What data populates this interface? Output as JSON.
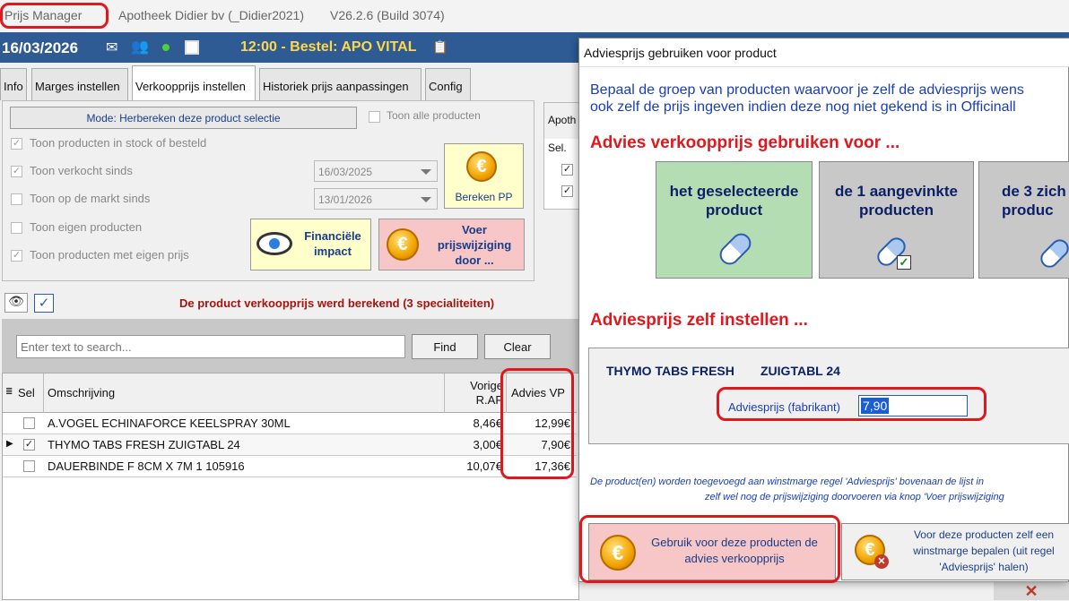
{
  "window": {
    "app_name": "Prijs Manager",
    "subtitle": "Apotheek Didier bv (_Didier2021)",
    "version": "V26.2.6  (Build 3074)"
  },
  "topbar": {
    "date": "16/03/2026",
    "order": "12:00 - Bestel: APO VITAL"
  },
  "tabs": [
    {
      "label": "Info"
    },
    {
      "label": "Marges instellen"
    },
    {
      "label": "Verkoopprijs instellen"
    },
    {
      "label": "Historiek prijs aanpassingen"
    },
    {
      "label": "Config"
    }
  ],
  "filters": {
    "mode_label": "Mode: Herbereken deze product selectie",
    "show_all": "Toon alle producten",
    "stock_label": "Toon producten in stock of besteld",
    "sold_label": "Toon verkocht sinds",
    "sold_date": "16/03/2025",
    "market_label": "Toon op de markt sinds",
    "market_date": "13/01/2026",
    "own_products": "Toon eigen producten",
    "own_price": "Toon producten met eigen prijs"
  },
  "actions": {
    "bereken": "Bereken PP",
    "financial": "Financiële impact",
    "execute": "Voer prijswijziging door ..."
  },
  "right_panel": {
    "header": "Apoth",
    "sel": "Sel."
  },
  "status_message": "De product verkoopprijs werd berekend (3 specialiteiten)",
  "search": {
    "placeholder": "Enter text to search...",
    "find": "Find",
    "clear": "Clear"
  },
  "table": {
    "headers": {
      "sel": "Sel",
      "desc": "Omschrijving",
      "prev": "Vorige R.AP",
      "advies": "Advies VP"
    },
    "rows": [
      {
        "checked": "",
        "desc": "A.VOGEL ECHINAFORCE KEELSPRAY  30ML",
        "prev": "8,46€",
        "advies": "12,99€"
      },
      {
        "checked": "✓",
        "desc": "THYMO TABS FRESH         ZUIGTABL 24",
        "prev": "3,00€",
        "advies": "7,90€"
      },
      {
        "checked": "",
        "desc": "DAUERBINDE F          8CM X 7M  1 105916",
        "prev": "10,07€",
        "advies": "17,36€"
      }
    ]
  },
  "dialog": {
    "title": "Adviesprijs gebruiken voor product",
    "intro1": "Bepaal de groep van producten waarvoor je zelf de adviesprijs wens",
    "intro2": "ook zelf de prijs ingeven indien deze nog niet gekend is in Officinall",
    "heading_use": "Advies verkoopprijs gebruiken voor ...",
    "opt1": "het geselecteerde product",
    "opt2": "de 1 aangevinkte producten",
    "opt3": "de 3 zich produc",
    "heading_set": "Adviesprijs zelf instellen ...",
    "product_name": "THYMO TABS FRESH",
    "product_form": "ZUIGTABL 24",
    "price_label": "Adviesprijs (fabrikant)",
    "price_value": "7,90",
    "note1": "De product(en) worden toegevoegd aan winstmarge regel 'Adviesprijs' bovenaan de lijst in",
    "note2": "zelf wel nog de prijswijziging doorvoeren via knop 'Voer prijswijziging",
    "btn_use": "Gebruik voor deze producten de advies verkoopprijs",
    "btn_own": "Voor deze producten zelf een winstmarge bepalen (uit regel 'Adviesprijs' halen)"
  },
  "colors": {
    "accent": "#e0181e",
    "topbar": "#2e5b94",
    "dialog_text": "#1a3db5"
  }
}
